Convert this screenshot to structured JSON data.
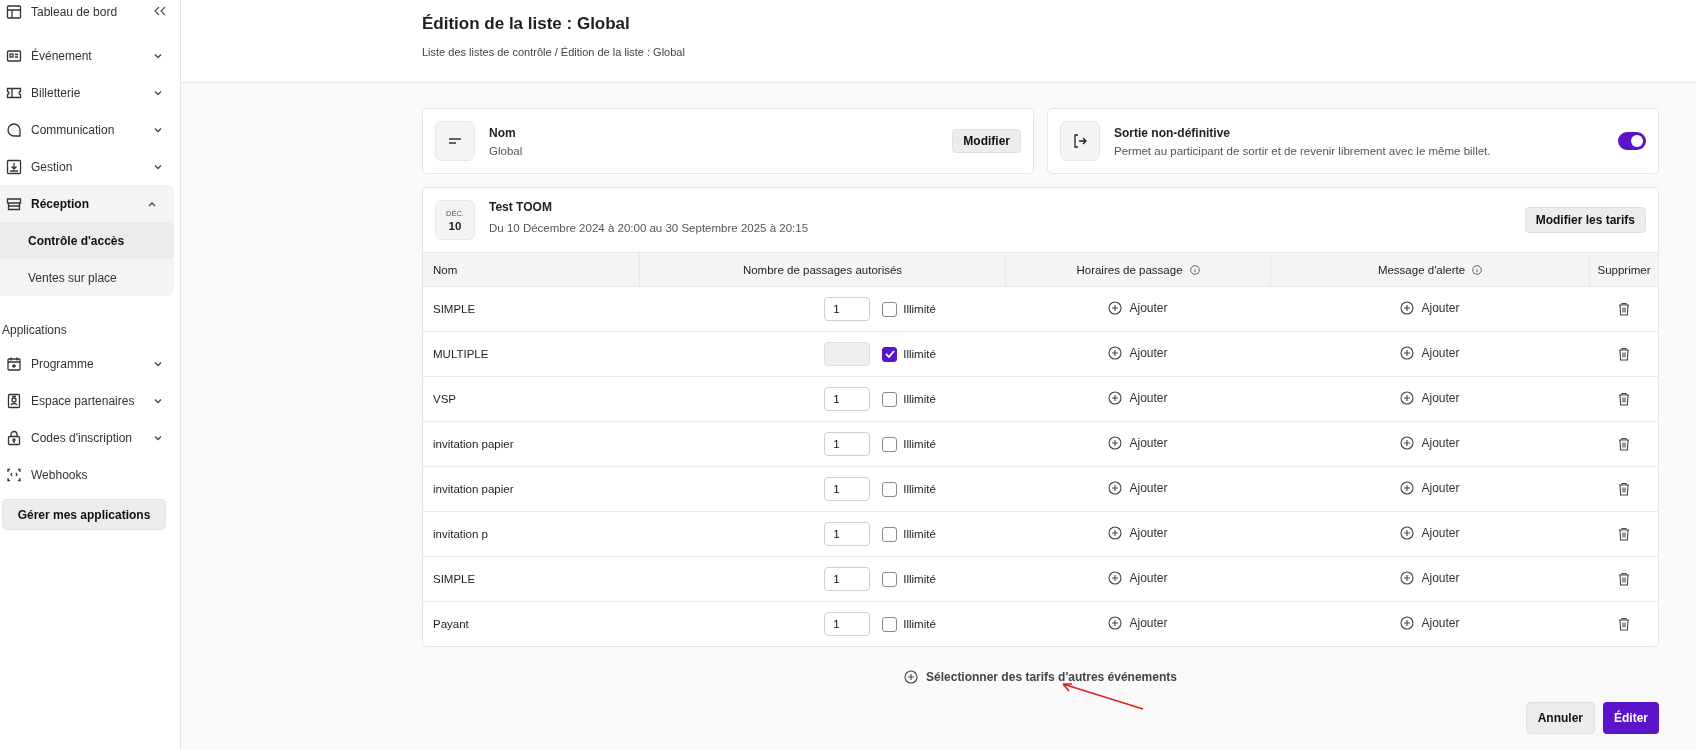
{
  "sidebar": {
    "items": [
      {
        "label": "Tableau de bord",
        "kind": "link",
        "expanded": false
      },
      {
        "label": "Événement",
        "kind": "menu",
        "expanded": false
      },
      {
        "label": "Billetterie",
        "kind": "menu",
        "expanded": false
      },
      {
        "label": "Communication",
        "kind": "menu",
        "expanded": false
      },
      {
        "label": "Gestion",
        "kind": "menu",
        "expanded": false
      },
      {
        "label": "Réception",
        "kind": "menu",
        "expanded": true,
        "children": [
          {
            "label": "Contrôle d'accès",
            "selected": true
          },
          {
            "label": "Ventes sur place",
            "selected": false
          }
        ]
      }
    ],
    "section_title": "Applications",
    "app_items": [
      {
        "label": "Programme",
        "kind": "menu",
        "expanded": false
      },
      {
        "label": "Espace partenaires",
        "kind": "menu",
        "expanded": false
      },
      {
        "label": "Codes d'inscription",
        "kind": "menu",
        "expanded": false
      },
      {
        "label": "Webhooks",
        "kind": "link",
        "expanded": false
      }
    ],
    "manage_button": "Gérer mes applications"
  },
  "header": {
    "title": "Édition de la liste : Global",
    "breadcrumb": "Liste des listes de contrôle / Édition de la liste : Global"
  },
  "name_card": {
    "label": "Nom",
    "value": "Global",
    "button": "Modifier"
  },
  "exit_card": {
    "label": "Sortie non-définitive",
    "description": "Permet au participant de sortir et de revenir librement avec le même billet.",
    "on": true
  },
  "event": {
    "month": "DÉC.",
    "day": "10",
    "title": "Test TOOM",
    "dates": "Du 10 Décembre 2024 à 20:00 au 30 Septembre 2025 à 20:15",
    "button": "Modifier les tarifs"
  },
  "table": {
    "columns": [
      "Nom",
      "Nombre de passages autorisés",
      "Horaires de passage",
      "Message d'alerte",
      "Supprimer"
    ],
    "rows": [
      {
        "name": "SIMPLE",
        "count": "1",
        "unlimited_label": "Illimité",
        "unlimited": false,
        "schedule": "Ajouter",
        "alert": "Ajouter"
      },
      {
        "name": "MULTIPLE",
        "unlimited_label": "Illimité",
        "unlimited": true,
        "schedule": "Ajouter",
        "alert": "Ajouter"
      },
      {
        "name": "VSP",
        "count": "1",
        "unlimited_label": "Illimité",
        "unlimited": false,
        "schedule": "Ajouter",
        "alert": "Ajouter"
      },
      {
        "name": "invitation papier",
        "count": "1",
        "unlimited_label": "Illimité",
        "unlimited": false,
        "schedule": "Ajouter",
        "alert": "Ajouter"
      },
      {
        "name": "invitation papier",
        "count": "1",
        "unlimited_label": "Illimité",
        "unlimited": false,
        "schedule": "Ajouter",
        "alert": "Ajouter"
      },
      {
        "name": "invitation p",
        "count": "1",
        "unlimited_label": "Illimité",
        "unlimited": false,
        "schedule": "Ajouter",
        "alert": "Ajouter"
      },
      {
        "name": "SIMPLE",
        "count": "1",
        "unlimited_label": "Illimité",
        "unlimited": false,
        "schedule": "Ajouter",
        "alert": "Ajouter"
      },
      {
        "name": "Payant",
        "count": "1",
        "unlimited_label": "Illimité",
        "unlimited": false,
        "schedule": "Ajouter",
        "alert": "Ajouter"
      }
    ]
  },
  "add_other": "Sélectionner des tarifs d'autres événements",
  "actions": {
    "cancel": "Annuler",
    "submit": "Éditer"
  }
}
